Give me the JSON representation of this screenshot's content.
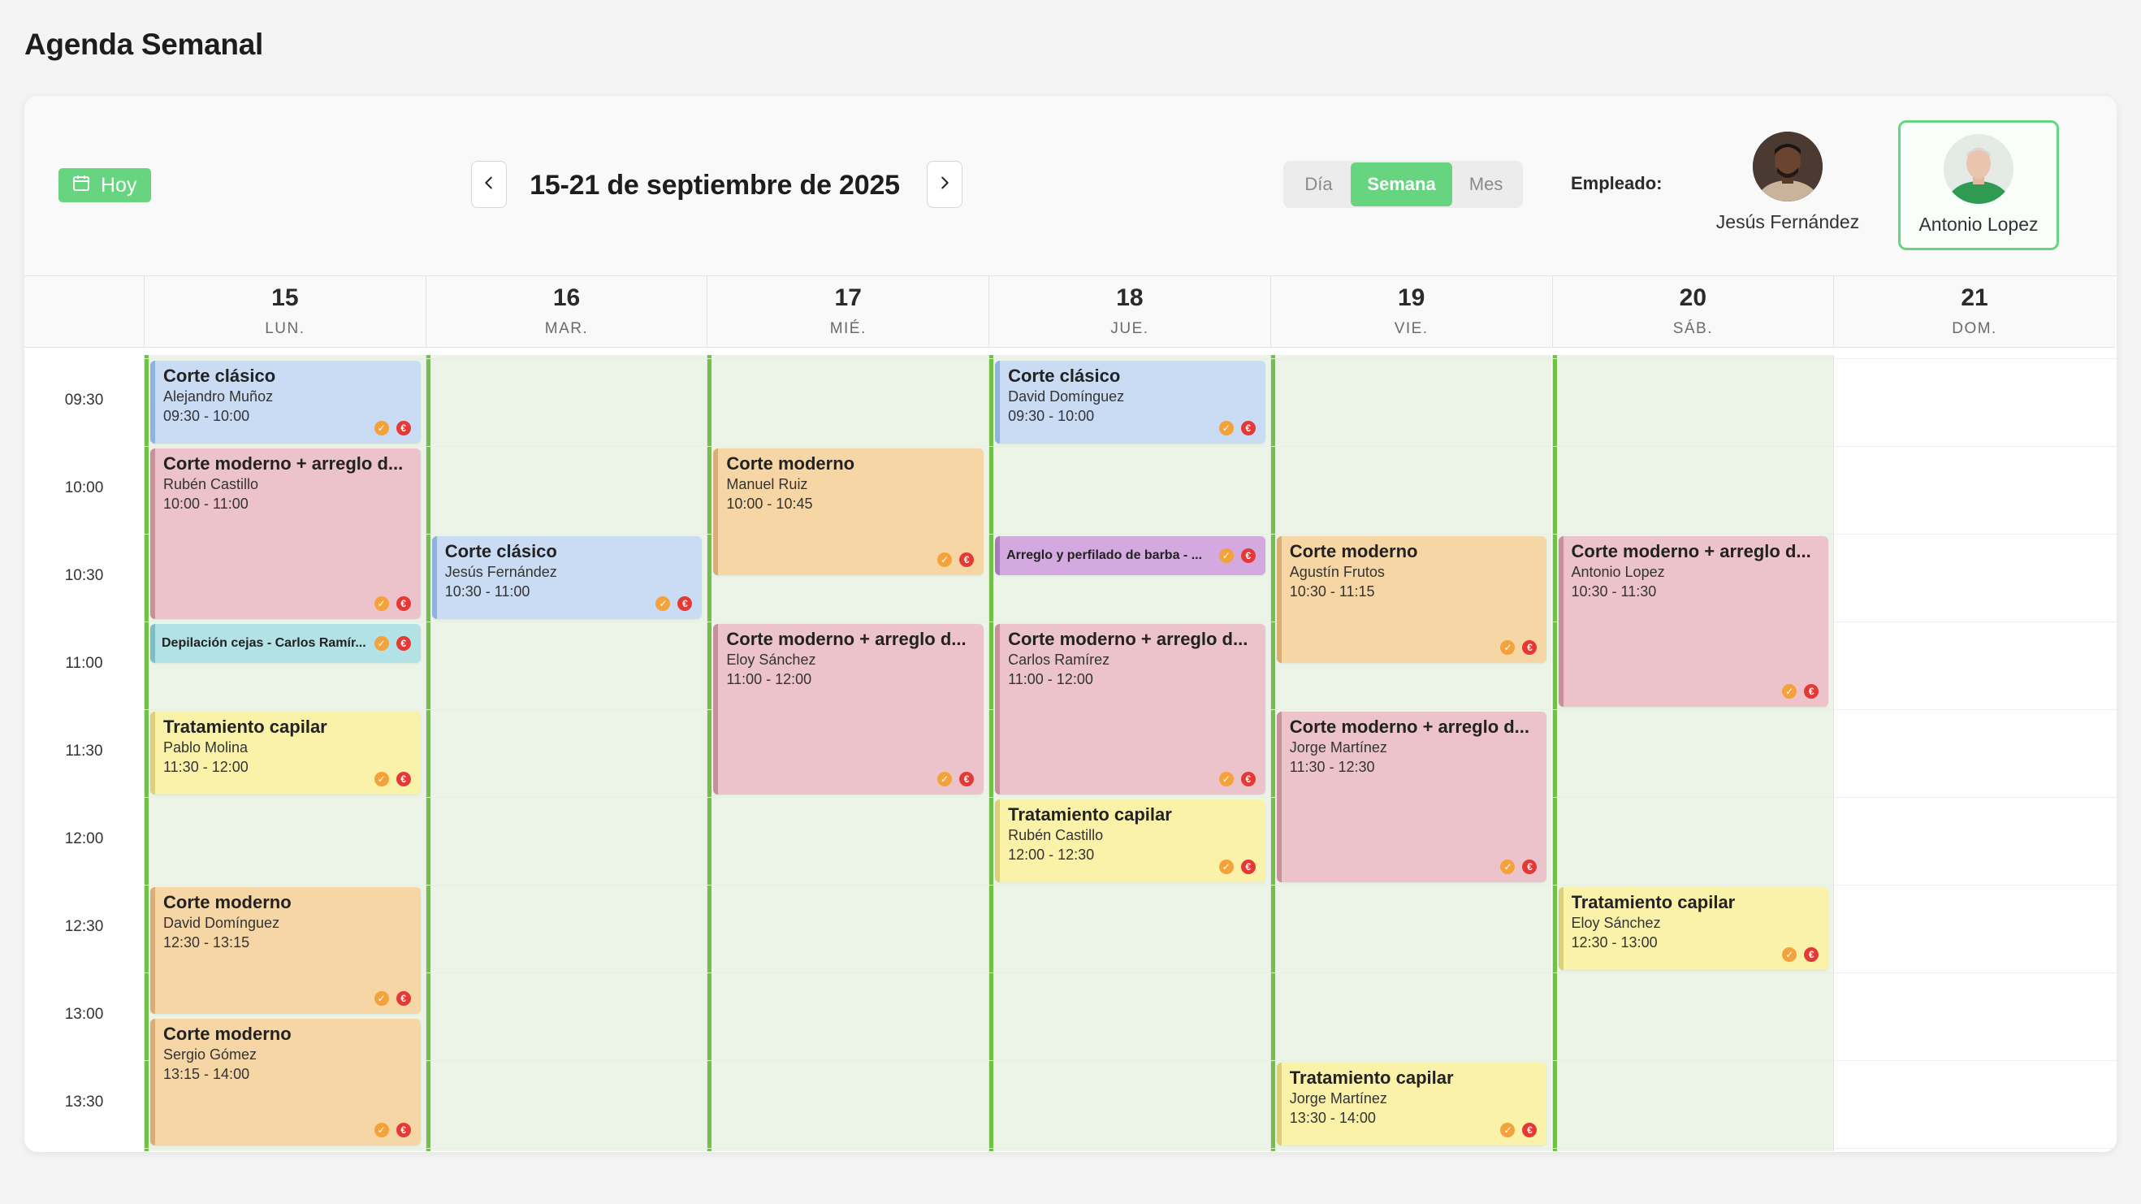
{
  "page_title": "Agenda Semanal",
  "toolbar": {
    "today_label": "Hoy",
    "range_label": "15-21 de septiembre de 2025",
    "views": [
      "Día",
      "Semana",
      "Mes"
    ],
    "active_view": "Semana",
    "employee_label": "Empleado:",
    "employees": [
      {
        "name": "Jesús Fernández",
        "selected": false
      },
      {
        "name": "Antonio Lopez",
        "selected": true
      }
    ]
  },
  "days": [
    {
      "num": "15",
      "name": "LUN.",
      "working": true
    },
    {
      "num": "16",
      "name": "MAR.",
      "working": true
    },
    {
      "num": "17",
      "name": "MIÉ.",
      "working": true
    },
    {
      "num": "18",
      "name": "JUE.",
      "working": true
    },
    {
      "num": "19",
      "name": "VIE.",
      "working": true
    },
    {
      "num": "20",
      "name": "SÁB.",
      "working": true
    },
    {
      "num": "21",
      "name": "DOM.",
      "working": false
    }
  ],
  "time_slots": [
    "09:30",
    "10:00",
    "10:30",
    "11:00",
    "11:30",
    "12:00",
    "12:30",
    "13:00",
    "13:30"
  ],
  "events": [
    {
      "day": 0,
      "start": "09:30",
      "end": "10:00",
      "title": "Corte clásico",
      "client": "Alejandro Muñoz",
      "time": "09:30 - 10:00",
      "color": "blue"
    },
    {
      "day": 0,
      "start": "10:00",
      "end": "11:00",
      "title": "Corte moderno + arreglo d...",
      "client": "Rubén Castillo",
      "time": "10:00 - 11:00",
      "color": "pink"
    },
    {
      "day": 0,
      "start": "11:00",
      "end": "11:15",
      "title": "Depilación cejas - Carlos Ramír...",
      "color": "teal",
      "compact": true
    },
    {
      "day": 0,
      "start": "11:30",
      "end": "12:00",
      "title": "Tratamiento capilar",
      "client": "Pablo Molina",
      "time": "11:30 - 12:00",
      "color": "yellow"
    },
    {
      "day": 0,
      "start": "12:30",
      "end": "13:15",
      "title": "Corte moderno",
      "client": "David Domínguez",
      "time": "12:30 - 13:15",
      "color": "orange"
    },
    {
      "day": 0,
      "start": "13:15",
      "end": "14:00",
      "title": "Corte moderno",
      "client": "Sergio Gómez",
      "time": "13:15 - 14:00",
      "color": "orange"
    },
    {
      "day": 1,
      "start": "10:30",
      "end": "11:00",
      "title": "Corte clásico",
      "client": "Jesús Fernández",
      "time": "10:30 - 11:00",
      "color": "blue"
    },
    {
      "day": 2,
      "start": "10:00",
      "end": "10:45",
      "title": "Corte moderno",
      "client": "Manuel Ruiz",
      "time": "10:00 - 10:45",
      "color": "orange"
    },
    {
      "day": 2,
      "start": "11:00",
      "end": "12:00",
      "title": "Corte moderno + arreglo d...",
      "client": "Eloy Sánchez",
      "time": "11:00 - 12:00",
      "color": "pink"
    },
    {
      "day": 3,
      "start": "09:30",
      "end": "10:00",
      "title": "Corte clásico",
      "client": "David Domínguez",
      "time": "09:30 - 10:00",
      "color": "blue"
    },
    {
      "day": 3,
      "start": "10:30",
      "end": "10:45",
      "title": "Arreglo y perfilado de barba - ...",
      "color": "purple",
      "compact": true
    },
    {
      "day": 3,
      "start": "11:00",
      "end": "12:00",
      "title": "Corte moderno + arreglo d...",
      "client": "Carlos Ramírez",
      "time": "11:00 - 12:00",
      "color": "pink"
    },
    {
      "day": 3,
      "start": "12:00",
      "end": "12:30",
      "title": "Tratamiento capilar",
      "client": "Rubén Castillo",
      "time": "12:00 - 12:30",
      "color": "yellow"
    },
    {
      "day": 4,
      "start": "10:30",
      "end": "11:15",
      "title": "Corte moderno",
      "client": "Agustín Frutos",
      "time": "10:30 - 11:15",
      "color": "orange"
    },
    {
      "day": 4,
      "start": "11:30",
      "end": "12:30",
      "title": "Corte moderno + arreglo d...",
      "client": "Jorge Martínez",
      "time": "11:30 - 12:30",
      "color": "pink"
    },
    {
      "day": 4,
      "start": "13:30",
      "end": "14:00",
      "title": "Tratamiento capilar",
      "client": "Jorge Martínez",
      "time": "13:30 - 14:00",
      "color": "yellow"
    },
    {
      "day": 5,
      "start": "10:30",
      "end": "11:30",
      "title": "Corte moderno + arreglo d...",
      "client": "Antonio Lopez",
      "time": "10:30 - 11:30",
      "color": "pink"
    },
    {
      "day": 5,
      "start": "12:30",
      "end": "13:00",
      "title": "Tratamiento capilar",
      "client": "Eloy Sánchez",
      "time": "12:30 - 13:00",
      "color": "yellow"
    }
  ],
  "status_icons": {
    "confirmed": "check-circle-icon",
    "payment": "euro-icon"
  },
  "colors": {
    "accent": "#67d47f",
    "working_bg": "#ebf4e7",
    "working_border": "#72c04a",
    "blue": "#c9dcf4",
    "pink": "#ecc3cb",
    "orange": "#f7d6a6",
    "yellow": "#fbf2a9",
    "teal": "#b3e2e6",
    "purple": "#d3a9e0"
  }
}
